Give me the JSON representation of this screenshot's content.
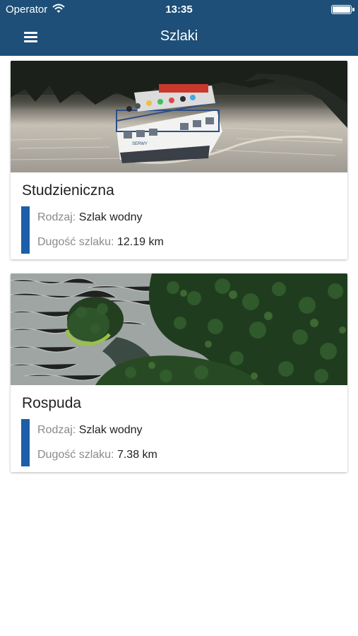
{
  "status_bar": {
    "carrier": "Operator",
    "time": "13:35"
  },
  "nav": {
    "title": "Szlaki"
  },
  "trails": [
    {
      "name": "Studzieniczna",
      "type_label": "Rodzaj:",
      "type_value": "Szlak wodny",
      "length_label": "Dugość szlaku:",
      "length_value": "12.19 km",
      "image": "lake-boat-photo",
      "boat_name": "SERWY"
    },
    {
      "name": "Rospuda",
      "type_label": "Rodzaj:",
      "type_value": "Szlak wodny",
      "length_label": "Dugość szlaku:",
      "length_value": "7.38 km",
      "image": "aerial-forest-river-photo"
    }
  ],
  "colors": {
    "nav_bar": "#1d4f78",
    "accent": "#1c5fa8",
    "label": "#8a8a8a"
  },
  "icons": {
    "menu": "hamburger-menu-icon",
    "wifi": "wifi-icon",
    "battery": "battery-icon"
  }
}
